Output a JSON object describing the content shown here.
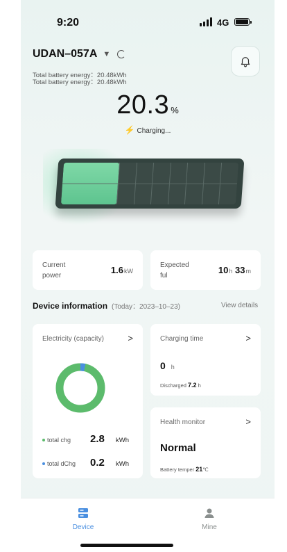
{
  "status_bar": {
    "time": "9:20",
    "network": "4G"
  },
  "device": {
    "name": "UDAN–057A",
    "energy_lines": [
      "Total battery energy：20.48kWh",
      "Total battery energy：20.48kWh"
    ],
    "charge_value": "20.3",
    "charge_unit": "%",
    "charging_label": "Charging...",
    "charge_fraction": 0.203
  },
  "metrics": {
    "current_power": {
      "label_line1": "Current",
      "label_line2": "power",
      "value": "1.6",
      "unit": "kW"
    },
    "expected_full": {
      "label_line1": "Expected",
      "label_line2": "ful",
      "hours": "10",
      "h_unit": "h",
      "minutes": "33",
      "m_unit": "m"
    }
  },
  "device_info": {
    "title": "Device information",
    "date_label": "(Today：2023–10–23)",
    "view_details": "View details"
  },
  "electricity_card": {
    "title": "Electricity (capacity)",
    "chevron": ">",
    "total_chg_label": "total chg",
    "total_chg_value": "2.8",
    "total_chg_unit": "kWh",
    "total_dchg_label": "total dChg",
    "total_dchg_value": "0.2",
    "total_dchg_unit": "kWh",
    "colors": {
      "chg": "#5cbb6c",
      "dchg": "#4a8fe0"
    }
  },
  "charging_time_card": {
    "title": "Charging time",
    "chevron": ">",
    "value": "0",
    "unit": "h",
    "discharged_label": "Discharged",
    "discharged_value": "7.2",
    "discharged_unit": "h"
  },
  "health_card": {
    "title": "Health monitor",
    "chevron": ">",
    "status": "Normal",
    "temp_label": "Battery temper",
    "temp_value": "21",
    "temp_unit": "℃"
  },
  "tabs": [
    {
      "label": "Device",
      "icon": "device-icon",
      "active": true,
      "color": "#4a8fe0"
    },
    {
      "label": "Mine",
      "icon": "person-icon",
      "active": false,
      "color": "#8a8f8e"
    }
  ]
}
